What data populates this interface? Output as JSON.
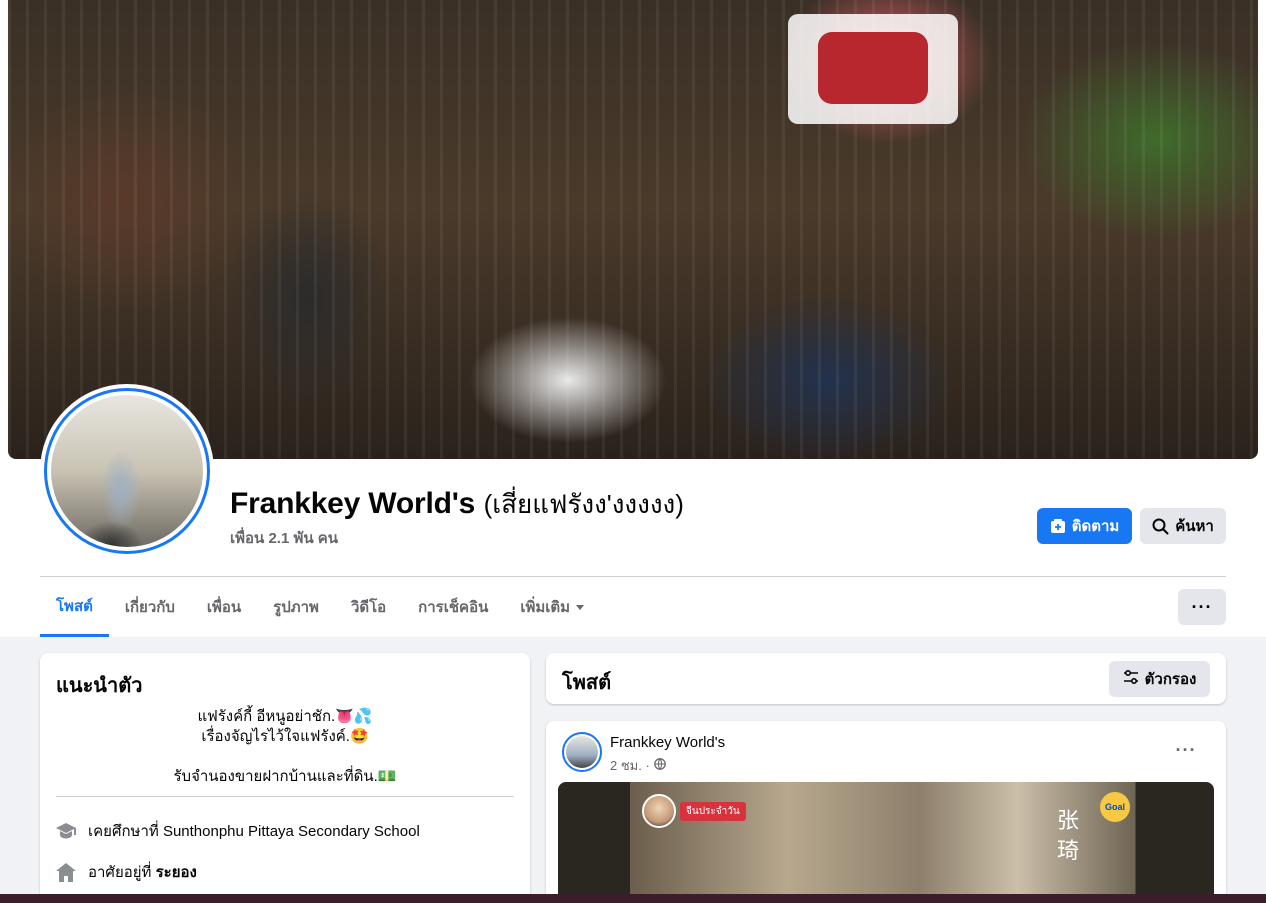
{
  "profile": {
    "name": "Frankkey World's",
    "alt_name": "(เสี่ยแฟรังง'งงงงง)",
    "friends": "เพื่อน 2.1 พัน คน"
  },
  "actions": {
    "follow_label": "ติดตาม",
    "search_label": "ค้นหา",
    "more_label": "···"
  },
  "tabs": [
    {
      "label": "โพสต์",
      "active": true
    },
    {
      "label": "เกี่ยวกับ",
      "active": false
    },
    {
      "label": "เพื่อน",
      "active": false
    },
    {
      "label": "รูปภาพ",
      "active": false
    },
    {
      "label": "วิดีโอ",
      "active": false
    },
    {
      "label": "การเช็คอิน",
      "active": false
    },
    {
      "label": "เพิ่มเติม",
      "active": false
    }
  ],
  "intro": {
    "title": "แนะนำตัว",
    "bio_line1": "แฟรังค์กี้ อีหนูอย่าชัก.👅💦",
    "bio_line2": "เรื่องจัญไรไว้ใจแฟรังค์.🤩",
    "bio_line3": "รับจำนองขายฝากบ้านและที่ดิน.💵",
    "education_prefix": "เคยศึกษาที่",
    "education_school": "Sunthonphu Pittaya Secondary School",
    "lives_prefix": "อาศัยอยู่ที่",
    "lives_place": "ระยอง"
  },
  "posts": {
    "title": "โพสต์",
    "filter_label": "ตัวกรอง"
  },
  "post": {
    "author": "Frankkey World's",
    "time": "2 ชม. ·",
    "menu": "···",
    "media_tag": "จีนประจำวัน",
    "media_chars": "张\n琦",
    "media_logo": "Goal"
  },
  "colors": {
    "accent": "#1877f2",
    "background": "#f0f2f5",
    "secondary_text": "#65676b"
  }
}
